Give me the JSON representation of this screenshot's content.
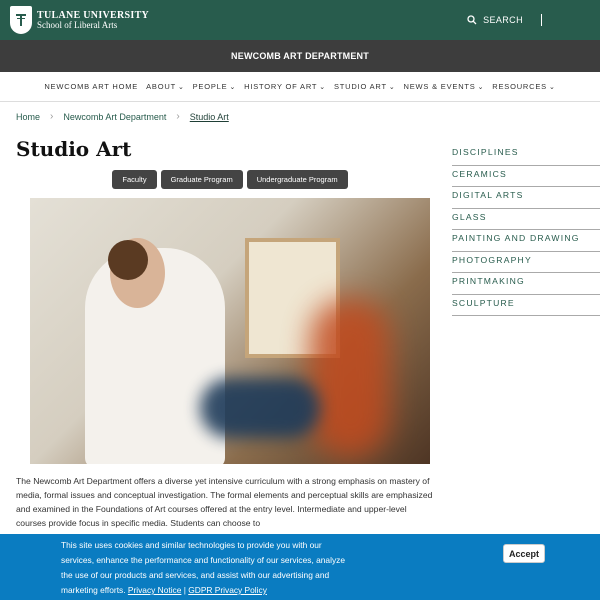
{
  "header": {
    "university": "TULANE UNIVERSITY",
    "school": "School of Liberal Arts",
    "search_label": "SEARCH"
  },
  "department_bar": "NEWCOMB ART DEPARTMENT",
  "nav": {
    "items": [
      {
        "label": "NEWCOMB ART HOME",
        "dropdown": false
      },
      {
        "label": "ABOUT",
        "dropdown": true
      },
      {
        "label": "PEOPLE",
        "dropdown": true
      },
      {
        "label": "HISTORY OF ART",
        "dropdown": true
      },
      {
        "label": "STUDIO ART",
        "dropdown": true
      },
      {
        "label": "NEWS & EVENTS",
        "dropdown": true
      },
      {
        "label": "RESOURCES",
        "dropdown": true
      }
    ]
  },
  "breadcrumb": [
    "Home",
    "Newcomb Art Department",
    "Studio Art"
  ],
  "page_title": "Studio Art",
  "tabs": [
    "Faculty",
    "Graduate Program",
    "Undergraduate Program"
  ],
  "body_text": "The Newcomb Art Department offers a diverse yet intensive curriculum with a strong emphasis on mastery of media, formal issues and conceptual investigation. The formal elements and perceptual skills are emphasized and examined in the Foundations of Art courses offered at the entry level. Intermediate and upper-level courses provide focus in specific media. Students can choose to",
  "sidebar": {
    "items": [
      "DISCIPLINES",
      "CERAMICS",
      "DIGITAL ARTS",
      "GLASS",
      "PAINTING AND DRAWING",
      "PHOTOGRAPHY",
      "PRINTMAKING",
      "SCULPTURE"
    ]
  },
  "cookie": {
    "text": "This site uses cookies and similar technologies to provide you with our services, enhance the performance and functionality of our services, analyze the use of our products and services, and assist with our advertising and marketing efforts.",
    "privacy_link": "Privacy Notice",
    "separator": "|",
    "gdpr_link": "GDPR Privacy Policy",
    "accept_label": "Accept"
  },
  "colors": {
    "brand_green": "#285c4d",
    "dept_bar": "#3d3d3d",
    "cookie_blue": "#0a7cc1"
  }
}
